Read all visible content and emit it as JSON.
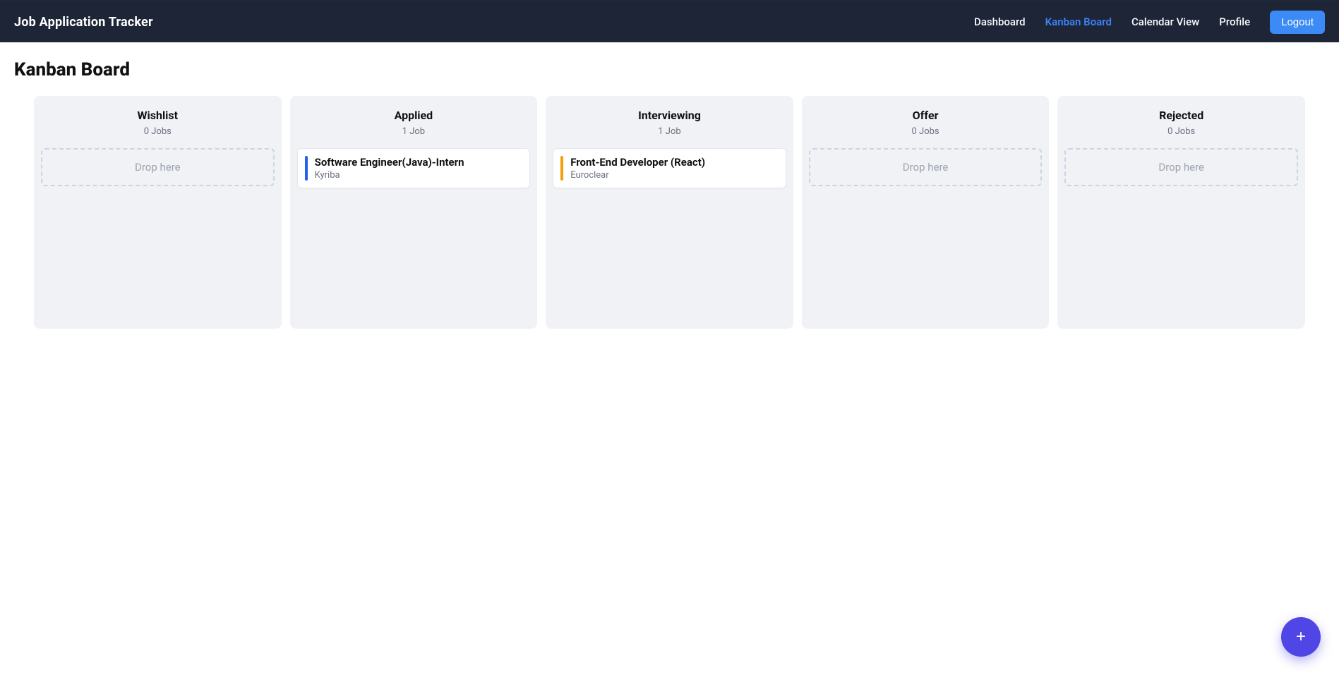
{
  "brand": "Job Application Tracker",
  "nav": {
    "dashboard": "Dashboard",
    "kanban": "Kanban Board",
    "calendar": "Calendar View",
    "profile": "Profile",
    "logout": "Logout"
  },
  "page_title": "Kanban Board",
  "drop_here": "Drop here",
  "fab_label": "+",
  "columns": [
    {
      "key": "wishlist",
      "title": "Wishlist",
      "count_text": "0 Jobs",
      "cards": []
    },
    {
      "key": "applied",
      "title": "Applied",
      "count_text": "1 Job",
      "cards": [
        {
          "title": "Software Engineer(Java)-Intern",
          "company": "Kyriba",
          "accent": "#2563eb"
        }
      ]
    },
    {
      "key": "interviewing",
      "title": "Interviewing",
      "count_text": "1 Job",
      "cards": [
        {
          "title": "Front-End Developer (React)",
          "company": "Euroclear",
          "accent": "#f59e0b"
        }
      ]
    },
    {
      "key": "offer",
      "title": "Offer",
      "count_text": "0 Jobs",
      "cards": []
    },
    {
      "key": "rejected",
      "title": "Rejected",
      "count_text": "0 Jobs",
      "cards": []
    }
  ]
}
